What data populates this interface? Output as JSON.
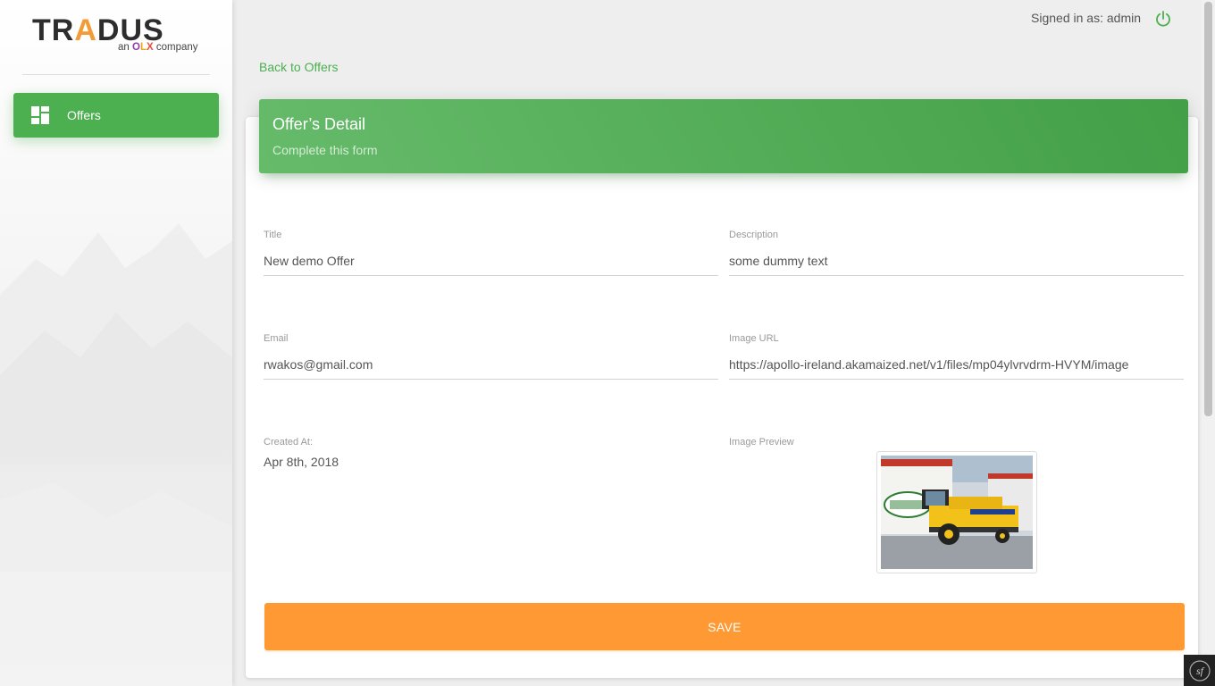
{
  "brand": {
    "wordmark_left": "TR",
    "wordmark_accent": "A",
    "wordmark_right": "DUS",
    "tagline_prefix": "an",
    "tagline_brand": [
      "O",
      "L",
      "X"
    ],
    "tagline_suffix": "company"
  },
  "sidebar": {
    "items": [
      {
        "label": "Offers",
        "icon": "dashboard-icon",
        "active": true
      }
    ]
  },
  "header": {
    "signed_in": "Signed in as: admin",
    "logout_icon": "power-icon"
  },
  "nav": {
    "back_link": "Back to Offers"
  },
  "card": {
    "title": "Offer’s Detail",
    "subtitle": "Complete this form"
  },
  "form": {
    "title": {
      "label": "Title",
      "value": "New demo Offer"
    },
    "description": {
      "label": "Description",
      "value": "some dummy text"
    },
    "email": {
      "label": "Email",
      "value": "rwakos@gmail.com"
    },
    "image_url": {
      "label": "Image URL",
      "value": "https://apollo-ireland.akamaized.net/v1/files/mp04ylvrvdrm-HVYM/image"
    },
    "created_at": {
      "label": "Created At:",
      "value": "Apr 8th, 2018"
    },
    "image_preview": {
      "label": "Image Preview"
    },
    "save_label": "SAVE"
  },
  "colors": {
    "primary": "#4caf50",
    "accent": "#ff9933",
    "brand_orange": "#f39b36"
  },
  "debug_toolbar": {
    "icon": "symfony-icon",
    "text": "sf"
  }
}
